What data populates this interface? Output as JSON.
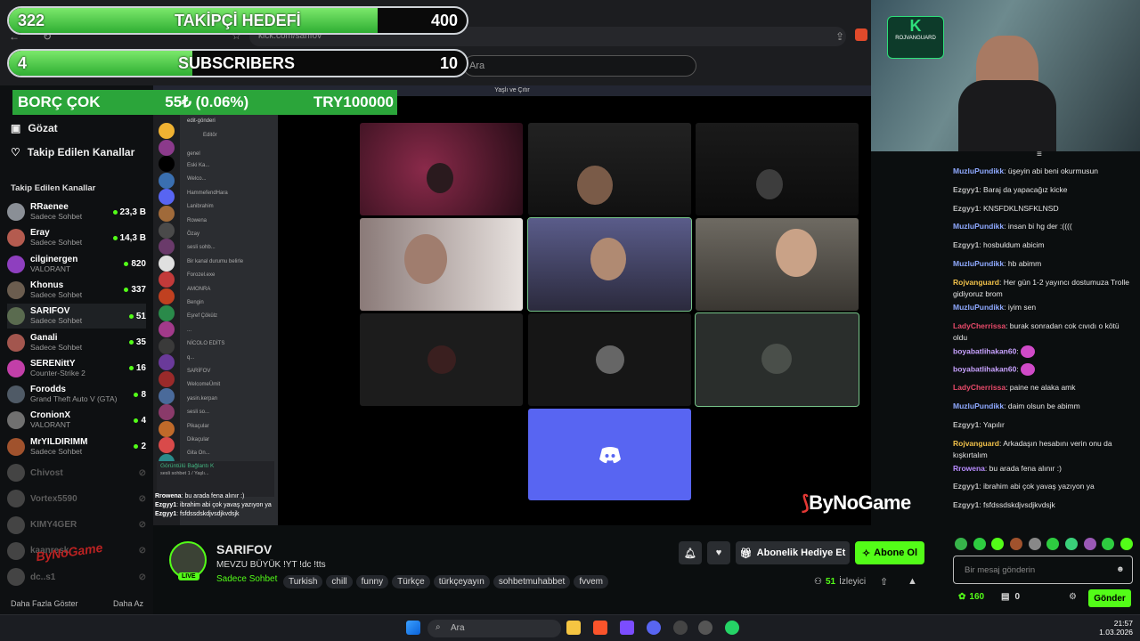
{
  "overlays": {
    "goal1": {
      "current": "322",
      "label": "TAKİPÇİ HEDEFİ",
      "target": "400",
      "progress": 0.805
    },
    "goal2": {
      "current": "4",
      "label": "SUBSCRIBERS",
      "target": "10",
      "progress": 0.4
    },
    "debt": {
      "label": "BORÇ ÇOK",
      "amount": "55₺ (0.06%)",
      "target": "TRY100000"
    }
  },
  "browser": {
    "url": "kick.com/sarifov",
    "search_placeholder": "Ara"
  },
  "sidebar": {
    "nav": [
      {
        "label": "Gözat",
        "icon": "compass-icon"
      },
      {
        "label": "Takip Edilen Kanallar",
        "icon": "heart-icon"
      }
    ],
    "section_title": "Takip Edilen Kanallar",
    "channels": [
      {
        "name": "RRaenee",
        "category": "Sadece Sohbet",
        "viewers": "23,3 B",
        "live": true,
        "color": "#8a8f96"
      },
      {
        "name": "Eray",
        "category": "Sadece Sohbet",
        "viewers": "14,3 B",
        "live": true,
        "color": "#b45b4f"
      },
      {
        "name": "cilginergen",
        "category": "VALORANT",
        "viewers": "820",
        "live": true,
        "color": "#8e3fbf"
      },
      {
        "name": "Khonus",
        "category": "Sadece Sohbet",
        "viewers": "337",
        "live": true,
        "color": "#6b5d4f"
      },
      {
        "name": "SARIFOV",
        "category": "Sadece Sohbet",
        "viewers": "51",
        "live": true,
        "color": "#5a6b4f"
      },
      {
        "name": "Ganali",
        "category": "Sadece Sohbet",
        "viewers": "35",
        "live": true,
        "color": "#a3564e"
      },
      {
        "name": "SERENittY",
        "category": "Counter-Strike 2",
        "viewers": "16",
        "live": true,
        "color": "#c23fa8"
      },
      {
        "name": "Forodds",
        "category": "Grand Theft Auto V (GTA)",
        "viewers": "8",
        "live": true,
        "color": "#4f5a66"
      },
      {
        "name": "CronionX",
        "category": "VALORANT",
        "viewers": "4",
        "live": true,
        "color": "#707070"
      },
      {
        "name": "MrYILDIRIMM",
        "category": "Sadece Sohbet",
        "viewers": "2",
        "live": true,
        "color": "#a0522d"
      },
      {
        "name": "Chivost",
        "category": "",
        "viewers": "",
        "live": false,
        "color": "#444"
      },
      {
        "name": "Vortex5590",
        "category": "",
        "viewers": "",
        "live": false,
        "color": "#444"
      },
      {
        "name": "KIMY4GER",
        "category": "",
        "viewers": "",
        "live": false,
        "color": "#444"
      },
      {
        "name": "kaanresk",
        "category": "",
        "viewers": "",
        "live": false,
        "color": "#444"
      },
      {
        "name": "dc..s1",
        "category": "",
        "viewers": "",
        "live": false,
        "color": "#444"
      }
    ],
    "show_more": "Daha Fazla Göster",
    "show_less": "Daha Az"
  },
  "discord": {
    "header": "edit-gönderi",
    "sub": "Editör",
    "section": "genel",
    "lines": [
      "Eski Ka...",
      "Welco...",
      "HammefendHara",
      "Lanibrahim",
      "Rowena",
      "Özay",
      "sesli sohb...",
      "Bir kanal durumu belirle",
      "Forozel.exe",
      "AMONRA",
      "Bengin",
      "Eşref Çökülz",
      "...",
      "NİCOLO EDİTS",
      "q...",
      "SARİFOV",
      "WelcomeÜmit",
      "yasin.kerpan",
      "sesli so...",
      "Pikaçular",
      "Dikaçular",
      "Gita On..."
    ],
    "voice_status": "Görüntülü Bağlantı K",
    "voice_sub": "sesli sohbet 1 / Yaşlı..."
  },
  "stream": {
    "window_title": "Yaşlı ve Çıtır",
    "overlay_chat": [
      {
        "user": "Rrowena",
        "text": "bu arada fena alınır :)"
      },
      {
        "user": "Ezgyy1",
        "text": "ibrahim abi çok yavaş yazıyon ya"
      },
      {
        "user": "Ezgyy1",
        "text": "fsfdssdskdjvsdjkvdsjk"
      }
    ],
    "sponsor": "ByNoGame",
    "watermark": "ByNoGame"
  },
  "channel": {
    "name": "SARIFOV",
    "live_badge": "LIVE",
    "title": "MEVZU BÜYÜK !YT !dc !tts",
    "category": "Sadece Sohbet",
    "tags": [
      "Turkish",
      "chill",
      "funny",
      "Türkçe",
      "türkçeyayın",
      "sohbetmuhabbet",
      "fvvem"
    ],
    "gift_label": "Abonelik Hediye Et",
    "subscribe_label": "Abone Ol",
    "viewers": "51",
    "viewers_label": "İzleyici"
  },
  "chat": {
    "messages": [
      {
        "user": "MuzluPundikk",
        "color": "#8fa9ff",
        "text": "üşeyin abi beni okurmusun"
      },
      {
        "user": "Ezgyy1",
        "color": "#bdbdbd",
        "text": "Baraj da yapacağız kicke"
      },
      {
        "user": "Ezgyy1",
        "color": "#bdbdbd",
        "text": "KNSFDKLNSFKLNSD"
      },
      {
        "user": "MuzluPundikk",
        "color": "#8fa9ff",
        "text": "insan bi hg der :(((("
      },
      {
        "user": "Ezgyy1",
        "color": "#bdbdbd",
        "text": "hosbuldum abicim"
      },
      {
        "user": "MuzluPundikk",
        "color": "#8fa9ff",
        "text": "hb abimm"
      },
      {
        "user": "Rojvanguard",
        "color": "#f0c04a",
        "text": "Her gün 1-2 yayıncı dostumuza Trolle gidiyoruz brom"
      },
      {
        "user": "MuzluPundikk",
        "color": "#8fa9ff",
        "text": "iyim sen"
      },
      {
        "user": "LadyCherrissa",
        "color": "#e84a6a",
        "text": "burak sonradan cok cıvıdı o kötü oldu"
      },
      {
        "user": "boyabatlihakan60",
        "color": "#c8a2ff",
        "text": ""
      },
      {
        "user": "boyabatlihakan60",
        "color": "#c8a2ff",
        "text": ""
      },
      {
        "user": "LadyCherrissa",
        "color": "#e84a6a",
        "text": "paine ne alaka amk"
      },
      {
        "user": "MuzluPundikk",
        "color": "#8fa9ff",
        "text": "daim olsun be abimm"
      },
      {
        "user": "Ezgyy1",
        "color": "#bdbdbd",
        "text": "Yapılır"
      },
      {
        "user": "Rojvanguard",
        "color": "#f0c04a",
        "text": "Arkadaşın hesabını verin onu da kışkırtalım"
      },
      {
        "user": "Rrowena",
        "color": "#b88cff",
        "text": "bu arada fena alınır :)"
      },
      {
        "user": "Ezgyy1",
        "color": "#bdbdbd",
        "text": "ibrahim abi çok yavaş yazıyon ya"
      },
      {
        "user": "Ezgyy1",
        "color": "#bdbdbd",
        "text": "fsfdssdskdjvsdjkvdsjk"
      }
    ],
    "input_placeholder": "Bir mesaj gönderin",
    "points": "160",
    "chest_count": "0",
    "send_label": "Gönder"
  },
  "webcam": {
    "logo_text": "ROJVANGUARD",
    "logo_initials": "K"
  },
  "taskbar": {
    "search_placeholder": "Ara",
    "time": "21:57",
    "date": "1.03.2026"
  },
  "colors": {
    "kick_green": "#53fc18",
    "bg": "#0b0e0f"
  }
}
